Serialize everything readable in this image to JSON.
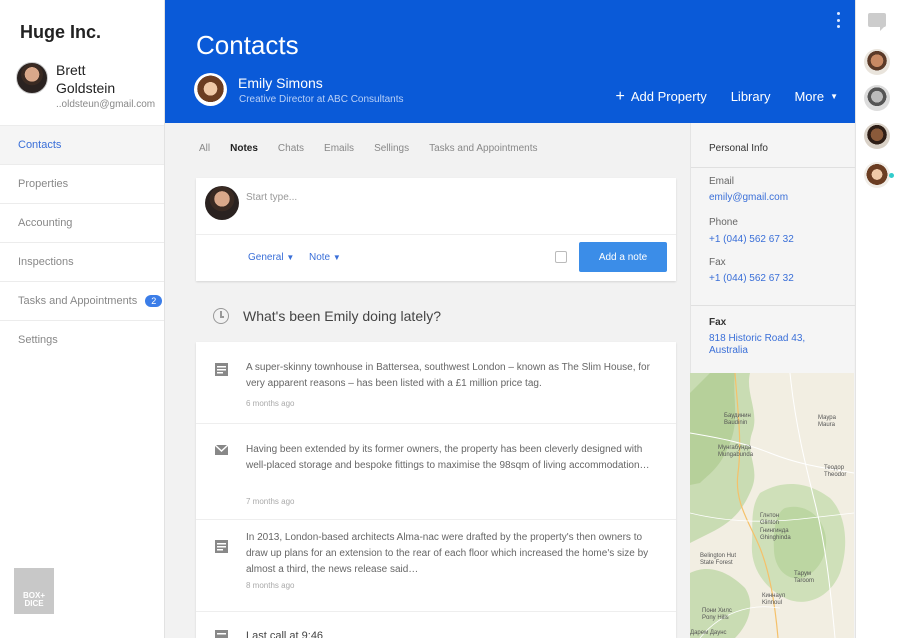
{
  "sidebar": {
    "company": "Huge Inc.",
    "user_first": "Brett",
    "user_last": "Goldstein",
    "user_email": "..oldsteun@gmail.com",
    "nav": [
      {
        "label": "Contacts",
        "active": true
      },
      {
        "label": "Properties"
      },
      {
        "label": "Accounting"
      },
      {
        "label": "Inspections"
      },
      {
        "label": "Tasks and Appointments",
        "badge": "2"
      },
      {
        "label": "Settings"
      }
    ],
    "brand": "BOX+ DICE"
  },
  "header": {
    "title": "Contacts",
    "contact_name": "Emily Simons",
    "contact_role": "Creative Director at ABC Consultants",
    "add_property": "Add Property",
    "library": "Library",
    "more": "More",
    "accent": "#0a5ad8"
  },
  "tabs": [
    "All",
    "Notes",
    "Chats",
    "Emails",
    "Sellings",
    "Tasks and Appointments"
  ],
  "compose": {
    "placeholder": "Start type...",
    "category": "General",
    "type": "Note",
    "add_note": "Add a note"
  },
  "activity": {
    "title": "What's been Emily doing lately?",
    "items": [
      {
        "icon": "document-icon",
        "text": "A super-skinny townhouse in Battersea, southwest London – known as The Slim House, for very apparent reasons – has been listed with a £1 million price tag.",
        "time": "6 months ago"
      },
      {
        "icon": "mail-icon",
        "text": "Having been extended by its former owners, the property has been cleverly designed with well-placed storage and bespoke fittings to maximise the 98sqm of living accommodation…",
        "time": "7 months ago"
      },
      {
        "icon": "document-icon",
        "text": "In 2013, London-based architects Alma-nac were drafted by the property's then owners to draw up plans for an extension to the rear of each floor which increased the home's size by almost a third, the news release said…",
        "time": "8 months ago"
      },
      {
        "icon": "document-icon",
        "text": "Last call at 9:46",
        "time": ""
      }
    ]
  },
  "info": {
    "title": "Personal Info",
    "email_label": "Email",
    "email": "emily@gmail.com",
    "phone_label": "Phone",
    "phone": "+1 (044) 562 67 32",
    "fax_label": "Fax",
    "fax": "+1 (044) 562 67 32",
    "fax2_label": "Fax",
    "address": "818 Historic Road 43, Australia"
  },
  "map": {
    "labels": [
      "Баудинин",
      "Baudinin",
      "Мунгабунда",
      "Mungabunda",
      "Маура",
      "Maura",
      "Теодор",
      "Theodor",
      "Глнтон",
      "Glinton",
      "Гнингинда",
      "Ghinghinda",
      "Belington Hut",
      "State Forest",
      "Тарум",
      "Taroom",
      "Киннаул",
      "Kinnoul",
      "Пони Хилс",
      "Pony Hills",
      "Дарем Даунс"
    ]
  }
}
